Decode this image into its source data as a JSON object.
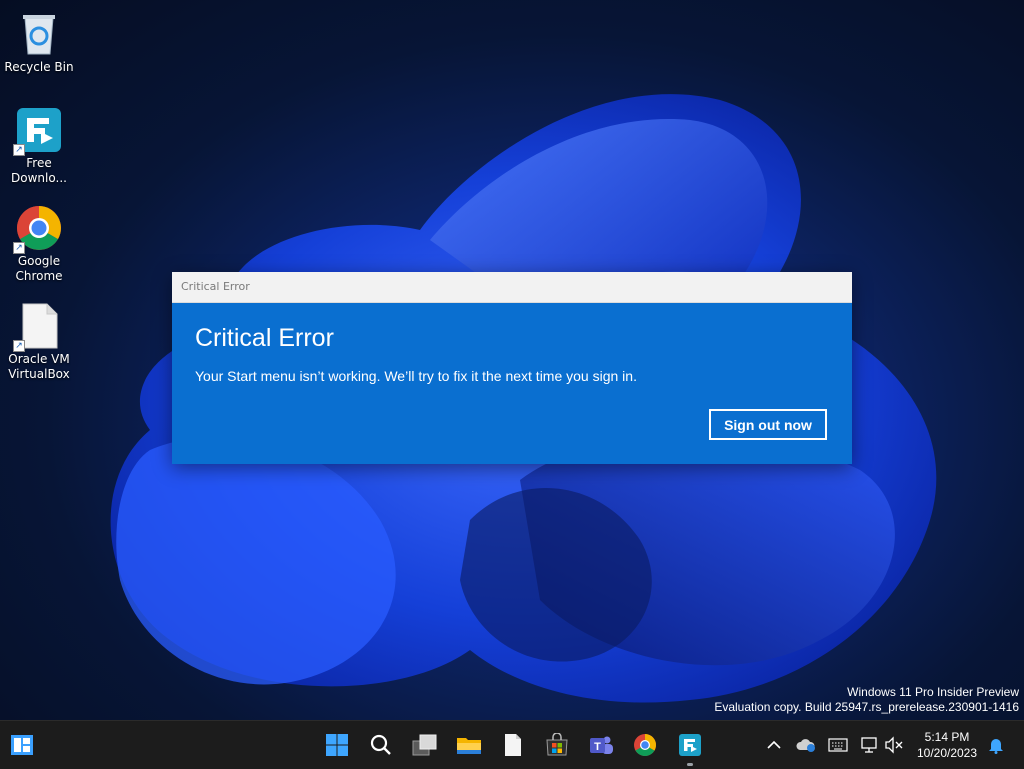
{
  "desktop": {
    "icons": [
      {
        "label": "Recycle Bin",
        "icon": "recycle-bin-icon"
      },
      {
        "label": "Free\nDownlo...",
        "icon": "free-download-manager-icon"
      },
      {
        "label": "Google\nChrome",
        "icon": "chrome-icon"
      },
      {
        "label": "Oracle VM\nVirtualBox",
        "icon": "blank-document-icon"
      }
    ]
  },
  "dialog": {
    "window_title": "Critical Error",
    "heading": "Critical Error",
    "message": "Your Start menu isn’t working. We’ll try to fix it the next time you sign in.",
    "button_label": "Sign out now",
    "accent_color": "#0a6fd0"
  },
  "watermark": {
    "line1": "Windows 11 Pro Insider Preview",
    "line2": "Evaluation copy. Build 25947.rs_prerelease.230901-1416"
  },
  "taskbar": {
    "left_icon": "widgets-icon",
    "apps": [
      "start-icon",
      "search-icon",
      "task-view-icon",
      "file-explorer-icon",
      "notepad-icon",
      "microsoft-store-icon",
      "teams-icon",
      "chrome-icon",
      "free-download-manager-icon"
    ],
    "tray": [
      "chevron-up-icon",
      "onedrive-icon",
      "keyboard-icon",
      "network-icon",
      "volume-muted-icon",
      "notification-bell-icon"
    ],
    "time": "5:14 PM",
    "date": "10/20/2023"
  }
}
